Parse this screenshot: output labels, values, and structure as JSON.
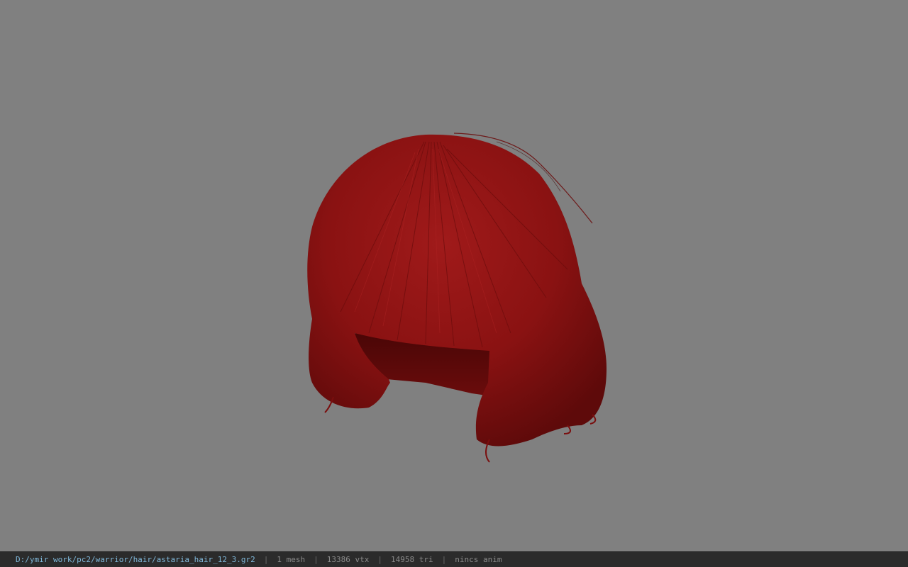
{
  "viewport": {
    "background": "#808080",
    "model_color": "#8e1414"
  },
  "statusbar": {
    "file_path": "D:/ymir work/pc2/warrior/hair/astaria_hair_12_3.gr2",
    "separator": "|",
    "mesh_count": "1 mesh",
    "vertex_count": "13386 vtx",
    "triangle_count": "14958 tri",
    "animation": "nincs anim"
  }
}
